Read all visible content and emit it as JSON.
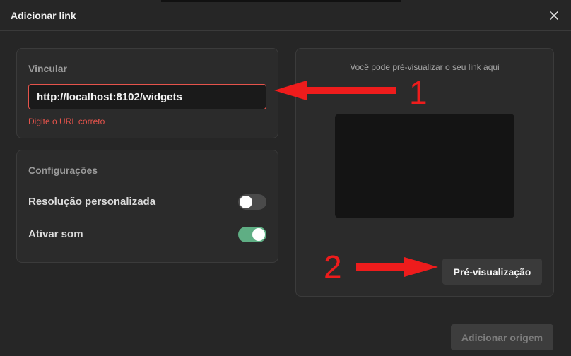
{
  "dialog": {
    "title": "Adicionar link"
  },
  "link_section": {
    "label": "Vincular",
    "url_value": "http://localhost:8102/widgets",
    "error_text": "Digite o URL correto"
  },
  "config_section": {
    "label": "Configurações",
    "options": [
      {
        "label": "Resolução personalizada",
        "enabled": false
      },
      {
        "label": "Ativar som",
        "enabled": true
      }
    ]
  },
  "preview_section": {
    "hint": "Você pode pré-visualizar o seu link aqui",
    "button_label": "Pré-visualização"
  },
  "footer": {
    "add_source_label": "Adicionar origem"
  },
  "annotations": {
    "marker_1": "1",
    "marker_2": "2",
    "color": "#ee1c1c"
  },
  "colors": {
    "error": "#e5534b",
    "toggle_on": "#5fae84",
    "toggle_off": "#4a4a4a"
  }
}
